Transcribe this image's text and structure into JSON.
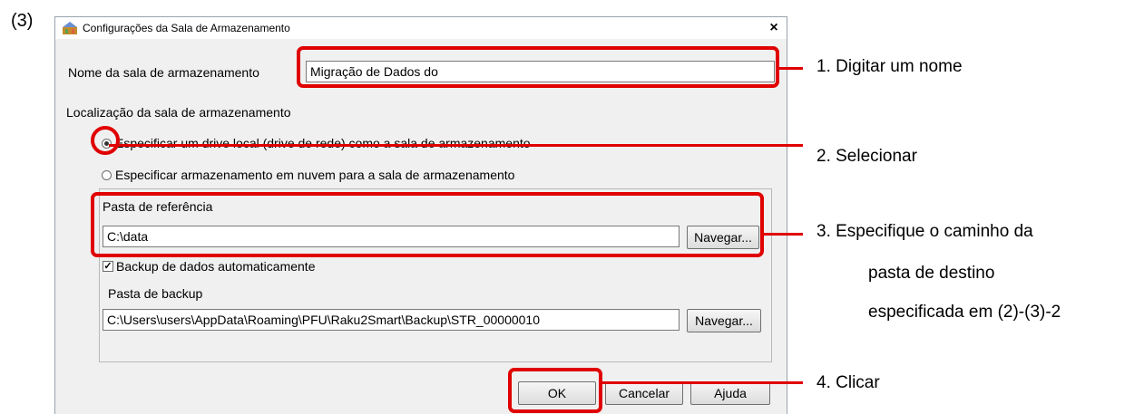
{
  "step_label": "(3)",
  "window": {
    "title": "Configurações da Sala de Armazenamento",
    "close_glyph": "×"
  },
  "form": {
    "name_label": "Nome da sala de armazenamento",
    "name_value": "Migração de Dados do",
    "location_heading": "Localização da sala de armazenamento",
    "radio_local_label": "Especificar um drive local (drive de rede) como a sala de armazenamento",
    "radio_local_selected": true,
    "radio_cloud_label": "Especificar armazenamento em nuvem para a sala de armazenamento",
    "radio_cloud_selected": false,
    "reference_folder_label": "Pasta de referência",
    "reference_folder_value": "C:\\data",
    "browse_label": "Navegar...",
    "auto_backup_label": "Backup de dados automaticamente",
    "auto_backup_checked": true,
    "backup_folder_label": "Pasta de backup",
    "backup_folder_value": "C:\\Users\\users\\AppData\\Roaming\\PFU\\Raku2Smart\\Backup\\STR_00000010",
    "browse2_label": "Navegar..."
  },
  "buttons": {
    "ok": "OK",
    "cancel": "Cancelar",
    "help": "Ajuda"
  },
  "annotations": {
    "step1": "1. Digitar um nome",
    "step2": "2. Selecionar",
    "step3_line1": "3. Especifique o caminho da",
    "step3_line2": "pasta de destino",
    "step3_line3": "especificada em (2)-(3)-2",
    "step4": "4. Clicar"
  },
  "colors": {
    "highlight": "#e00000",
    "dialog_bg": "#f0f0f0"
  }
}
